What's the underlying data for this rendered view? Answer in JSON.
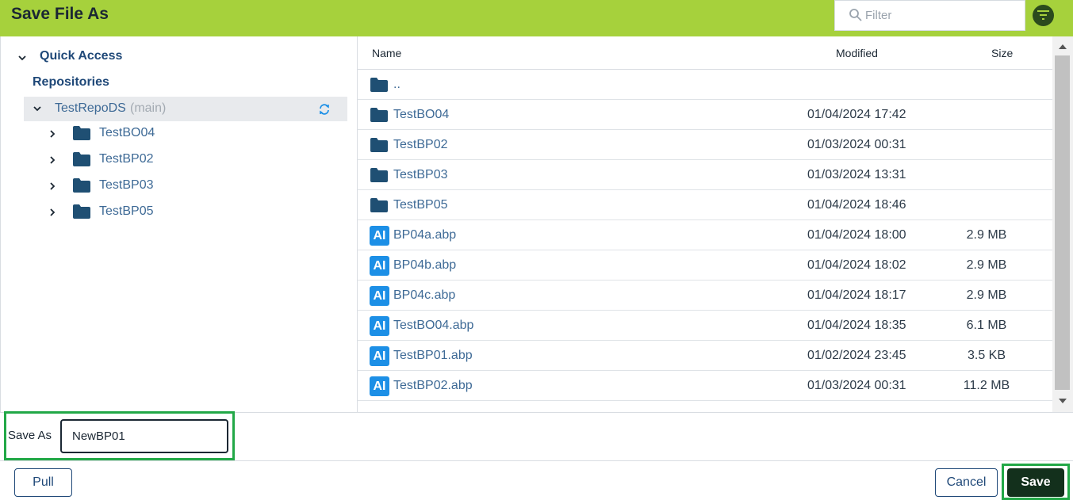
{
  "dialog": {
    "title": "Save File As",
    "filter_placeholder": "Filter"
  },
  "tree": {
    "quick_access": "Quick Access",
    "repositories": "Repositories",
    "repo": {
      "name": "TestRepoDS",
      "branch": "(main)"
    },
    "folders": [
      {
        "label": "TestBO04"
      },
      {
        "label": "TestBP02"
      },
      {
        "label": "TestBP03"
      },
      {
        "label": "TestBP05"
      }
    ]
  },
  "list": {
    "columns": {
      "name": "Name",
      "modified": "Modified",
      "size": "Size"
    },
    "parent": "..",
    "rows": [
      {
        "name": "TestBO04",
        "modified": "01/04/2024 17:42",
        "size": "",
        "type": "folder"
      },
      {
        "name": "TestBP02",
        "modified": "01/03/2024 00:31",
        "size": "",
        "type": "folder"
      },
      {
        "name": "TestBP03",
        "modified": "01/03/2024 13:31",
        "size": "",
        "type": "folder"
      },
      {
        "name": "TestBP05",
        "modified": "01/04/2024 18:46",
        "size": "",
        "type": "folder"
      },
      {
        "name": "BP04a.abp",
        "modified": "01/04/2024 18:00",
        "size": "2.9 MB",
        "type": "file"
      },
      {
        "name": "BP04b.abp",
        "modified": "01/04/2024 18:02",
        "size": "2.9 MB",
        "type": "file"
      },
      {
        "name": "BP04c.abp",
        "modified": "01/04/2024 18:17",
        "size": "2.9 MB",
        "type": "file"
      },
      {
        "name": "TestBO04.abp",
        "modified": "01/04/2024 18:35",
        "size": "6.1 MB",
        "type": "file"
      },
      {
        "name": "TestBP01.abp",
        "modified": "01/02/2024 23:45",
        "size": "3.5 KB",
        "type": "file"
      },
      {
        "name": "TestBP02.abp",
        "modified": "01/03/2024 00:31",
        "size": "11.2 MB",
        "type": "file"
      }
    ],
    "file_icon_text": "AI"
  },
  "save_as": {
    "label": "Save As",
    "value": "NewBP01"
  },
  "footer": {
    "pull_label": "Pull",
    "cancel_label": "Cancel",
    "save_label": "Save"
  },
  "colors": {
    "header_bg": "#a6d13c",
    "folder_icon": "#1f4f73",
    "file_icon": "#1c8fe6",
    "highlight": "#22a847",
    "save_button": "#13301c"
  }
}
